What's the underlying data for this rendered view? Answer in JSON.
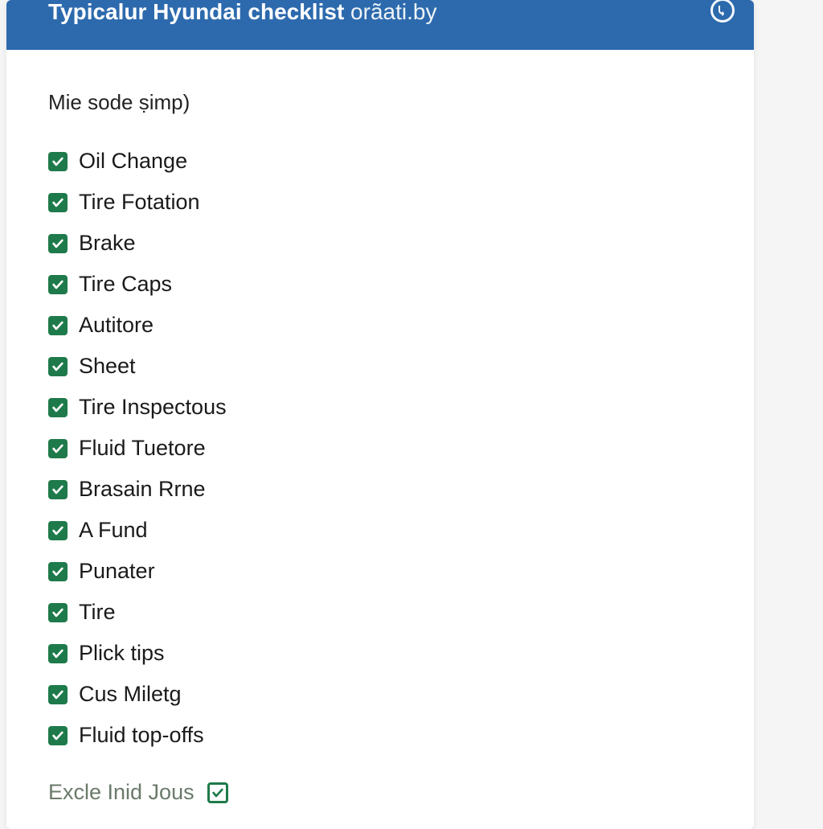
{
  "header": {
    "title_bold": "Typicalur Hyundai checklist",
    "title_light": " orãati.by"
  },
  "subtitle": "Mie sode ṣimp)",
  "items": [
    {
      "label": "Oil Change",
      "checked": true
    },
    {
      "label": "Tire Fotation",
      "checked": true
    },
    {
      "label": "Brake",
      "checked": true
    },
    {
      "label": "Tire Caps",
      "checked": true
    },
    {
      "label": "Autitore",
      "checked": true
    },
    {
      "label": "Sheet",
      "checked": true
    },
    {
      "label": "Tire Inspectous",
      "checked": true
    },
    {
      "label": "Fluid Tuetore",
      "checked": true
    },
    {
      "label": "Brasain Rrne",
      "checked": true
    },
    {
      "label": "A Fund",
      "checked": true
    },
    {
      "label": "Punater",
      "checked": true
    },
    {
      "label": "Tire",
      "checked": true
    },
    {
      "label": "Plick tips",
      "checked": true
    },
    {
      "label": "Cus Miletg",
      "checked": true
    },
    {
      "label": "Fluid top-offs",
      "checked": true
    }
  ],
  "footer": {
    "label": "Excle Inid Jous",
    "checked": true
  },
  "colors": {
    "header_bg": "#2d6aad",
    "checkbox_bg": "#1e7a4a"
  }
}
